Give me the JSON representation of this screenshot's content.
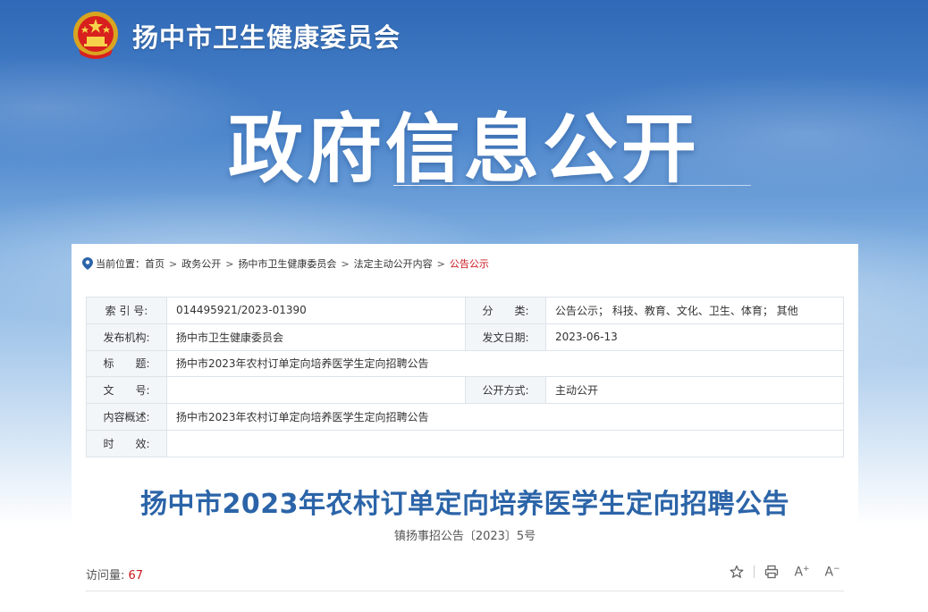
{
  "site": {
    "name": "扬中市卫生健康委员会",
    "hero_title": "政府信息公开"
  },
  "breadcrumb": {
    "prefix": "当前位置：",
    "items": [
      "首页",
      "政务公开",
      "扬中市卫生健康委员会",
      "法定主动公开内容",
      "公告公示"
    ],
    "separator": ">"
  },
  "meta": {
    "index_label": "索 引 号:",
    "index_value": "014495921/2023-01390",
    "category_label": "分　　类:",
    "category_value": "公告公示；  科技、教育、文化、卫生、体育；  其他",
    "publisher_label": "发布机构:",
    "publisher_value": "扬中市卫生健康委员会",
    "date_label": "发文日期:",
    "date_value": "2023-06-13",
    "title_label": "标　　题:",
    "title_value": "扬中市2023年农村订单定向培养医学生定向招聘公告",
    "docno_label": "文　　号:",
    "docno_value": "",
    "mode_label": "公开方式:",
    "mode_value": "主动公开",
    "summary_label": "内容概述:",
    "summary_value": "扬中市2023年农村订单定向培养医学生定向招聘公告",
    "validity_label": "时　　效:",
    "validity_value": ""
  },
  "article": {
    "title": "扬中市2023年农村订单定向培养医学生定向招聘公告",
    "doc_number": "镇扬事招公告〔2023〕5号",
    "visits_label": "访问量:",
    "visits_count": "67"
  },
  "toolbar": {
    "icons": [
      "star-icon",
      "print-icon",
      "font-increase-icon",
      "font-decrease-icon"
    ],
    "font_increase": "A",
    "font_decrease": "A"
  },
  "colors": {
    "accent_red": "#c8161d",
    "title_blue": "#2b64a8",
    "banner_blue": "#2f69b7"
  }
}
